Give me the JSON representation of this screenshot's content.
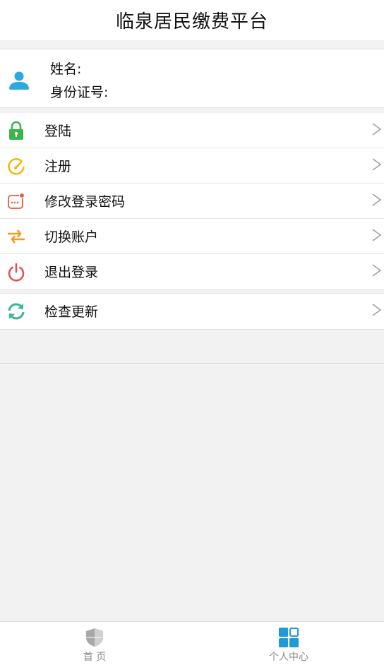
{
  "header": {
    "title": "临泉居民缴费平台"
  },
  "profile": {
    "name_label": "姓名:",
    "id_label": "身份证号:",
    "avatar_color": "#2aa8e0"
  },
  "menu": [
    {
      "label": "登陆",
      "icon": "lock-icon",
      "color": "#3bb54a"
    },
    {
      "label": "注册",
      "icon": "gauge-icon",
      "color": "#f4b400"
    },
    {
      "label": "修改登录密码",
      "icon": "password-icon",
      "color": "#e85b3a"
    },
    {
      "label": "切换账户",
      "icon": "switch-arrows-icon",
      "color": "#f39a1e"
    },
    {
      "label": "退出登录",
      "icon": "power-icon",
      "color": "#e25252"
    }
  ],
  "menu2": [
    {
      "label": "检查更新",
      "icon": "refresh-icon",
      "color": "#3bb89a"
    }
  ],
  "tabbar": {
    "home_label": "首 页",
    "me_label": "个人中心",
    "active_color": "#1e9ad6",
    "inactive_color": "#8a8a8a"
  }
}
